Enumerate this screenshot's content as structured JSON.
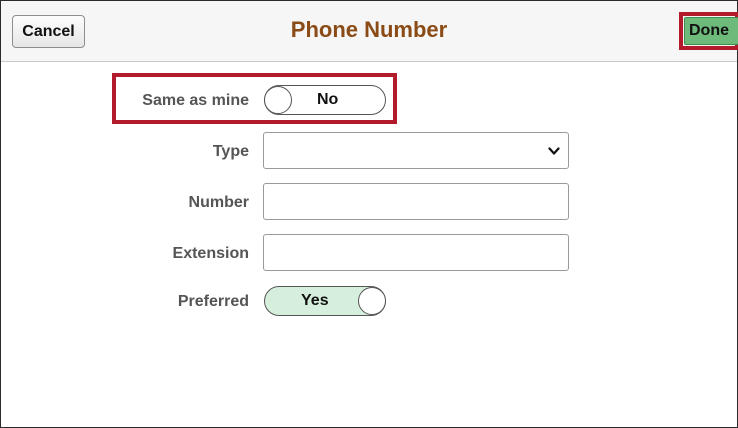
{
  "header": {
    "cancel_label": "Cancel",
    "title": "Phone Number",
    "done_label": "Done"
  },
  "form": {
    "same_as_mine": {
      "label": "Same as mine",
      "value": "No",
      "on": false
    },
    "type": {
      "label": "Type",
      "value": ""
    },
    "number": {
      "label": "Number",
      "value": ""
    },
    "extension": {
      "label": "Extension",
      "value": ""
    },
    "preferred": {
      "label": "Preferred",
      "value": "Yes",
      "on": true
    }
  },
  "colors": {
    "title": "#8a4b16",
    "done_button": "#6dba7a",
    "highlight": "#b31a2c",
    "toggle_on": "#d6efdc"
  },
  "icons": {
    "type_dropdown": "chevron-down-icon"
  }
}
